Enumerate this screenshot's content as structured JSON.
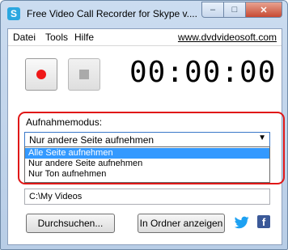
{
  "window": {
    "title": "Free Video Call Recorder for Skype v....",
    "icon": "skype-icon",
    "buttons": {
      "minimize": "–",
      "maximize": "□",
      "close": "✕"
    }
  },
  "menu": {
    "items": [
      "Datei",
      "Tools",
      "Hilfe"
    ],
    "site_link": "www.dvdvideosoft.com"
  },
  "controls": {
    "record_icon": "record-icon",
    "stop_icon": "stop-icon",
    "timer": "00:00:00"
  },
  "mode": {
    "label": "Aufnahmemodus:",
    "selected": "Nur andere Seite aufnehmen",
    "options": [
      "Alle Seite aufnehmen",
      "Nur andere Seite aufnehmen",
      "Nur Ton aufnehmen"
    ],
    "highlighted_index": 0
  },
  "output": {
    "path": "C:\\My Videos"
  },
  "buttons": {
    "browse": "Durchsuchen...",
    "open_folder": "In Ordner anzeigen"
  },
  "social": {
    "twitter": "twitter-icon",
    "facebook": "f"
  },
  "colors": {
    "highlight": "#e01717",
    "record": "#ef1818",
    "selection": "#3399ff"
  }
}
